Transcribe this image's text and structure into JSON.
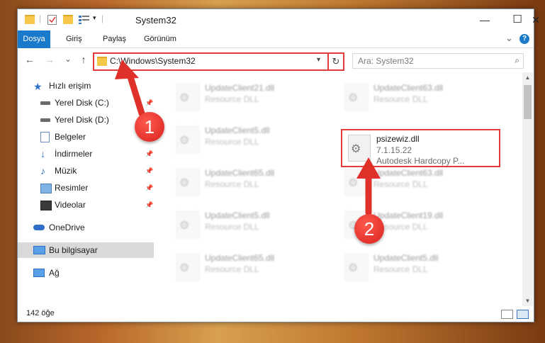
{
  "window": {
    "title": "System32",
    "minimize": "—",
    "maximize": "☐",
    "close": "✕"
  },
  "ribbon": {
    "tabs": [
      "Dosya",
      "Giriş",
      "Paylaş",
      "Görünüm"
    ],
    "collapse": "⌄",
    "help": "?"
  },
  "nav": {
    "back": "←",
    "forward": "→",
    "recent": "⌄",
    "up": "↑",
    "address": "C:\\Windows\\System32",
    "refresh": "↻",
    "search_placeholder": "Ara: System32",
    "search_icon": "🔍"
  },
  "sidebar": {
    "items": [
      {
        "label": "Hızlı erişim",
        "icon": "star-icon",
        "pinned": false
      },
      {
        "label": "Yerel Disk (C:)",
        "icon": "drive-icon",
        "pinned": true
      },
      {
        "label": "Yerel Disk (D:)",
        "icon": "drive-icon",
        "pinned": true
      },
      {
        "label": "Belgeler",
        "icon": "documents-icon",
        "pinned": true
      },
      {
        "label": "İndirmeler",
        "icon": "downloads-icon",
        "pinned": true
      },
      {
        "label": "Müzik",
        "icon": "music-icon",
        "pinned": true
      },
      {
        "label": "Resimler",
        "icon": "pictures-icon",
        "pinned": true
      },
      {
        "label": "Videolar",
        "icon": "videos-icon",
        "pinned": true
      },
      {
        "label": "OneDrive",
        "icon": "cloud-icon",
        "pinned": false
      },
      {
        "label": "Bu bilgisayar",
        "icon": "computer-icon",
        "pinned": false,
        "selected": true
      },
      {
        "label": "Ağ",
        "icon": "network-icon",
        "pinned": false
      }
    ],
    "pin_glyph": "📌"
  },
  "files": [
    {
      "name": "UpdateClient21.dll",
      "line1": "Resource DLL",
      "line2": ""
    },
    {
      "name": "UpdateClient63.dll",
      "line1": "Resource DLL",
      "line2": ""
    },
    {
      "name": "UpdateClient5.dll",
      "line1": "Resource DLL",
      "line2": ""
    },
    {
      "name": "psizewiz.dll",
      "line1": "7.1.15.22",
      "line2": "Autodesk Hardcopy P..."
    },
    {
      "name": "UpdateClient65.dll",
      "line1": "Resource DLL",
      "line2": ""
    },
    {
      "name": "UpdateClient63.dll",
      "line1": "Resource DLL",
      "line2": ""
    },
    {
      "name": "UpdateClient5.dll",
      "line1": "Resource DLL",
      "line2": ""
    },
    {
      "name": "UpdateClient19.dll",
      "line1": "Resource DLL",
      "line2": ""
    },
    {
      "name": "UpdateClient65.dll",
      "line1": "Resource DLL",
      "line2": ""
    },
    {
      "name": "UpdateClient5.dll",
      "line1": "Resource DLL",
      "line2": ""
    }
  ],
  "status": {
    "count": "142 öğe"
  },
  "annotations": {
    "badge1": "1",
    "badge2": "2"
  },
  "colors": {
    "accent": "#1979ca",
    "highlight": "#e33a3a",
    "badge": "#e0302a"
  }
}
